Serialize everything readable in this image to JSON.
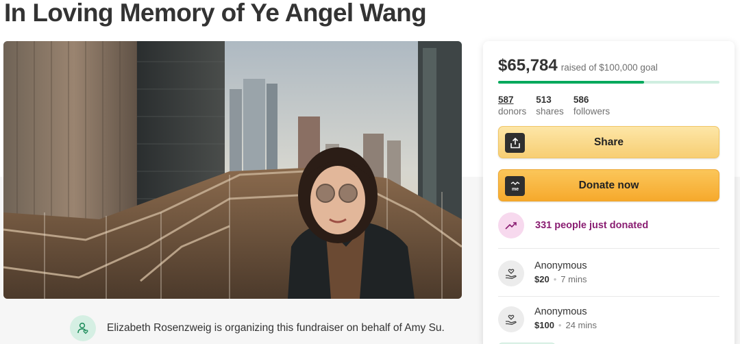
{
  "page": {
    "title": "In Loving Memory of Ye Angel Wang"
  },
  "organizer": {
    "text": "Elizabeth Rosenzweig is organizing this fundraiser on behalf of Amy Su.",
    "icon": "user-heart-icon"
  },
  "donation": {
    "raised": "$65,784",
    "goal_text": "raised of $100,000 goal",
    "progress_fraction": 0.658,
    "stats": [
      {
        "value": "587",
        "label": "donors"
      },
      {
        "value": "513",
        "label": "shares"
      },
      {
        "value": "586",
        "label": "followers"
      }
    ],
    "share_label": "Share",
    "donate_label": "Donate now",
    "trend_text": "331 people just donated",
    "donors": [
      {
        "name": "Anonymous",
        "amount": "$20",
        "time": "7 mins"
      },
      {
        "name": "Anonymous",
        "amount": "$100",
        "time": "24 mins"
      }
    ]
  },
  "colors": {
    "brand_green": "#02a95c",
    "donate_orange": "#f6a92c",
    "trend_purple": "#8a1e72"
  }
}
